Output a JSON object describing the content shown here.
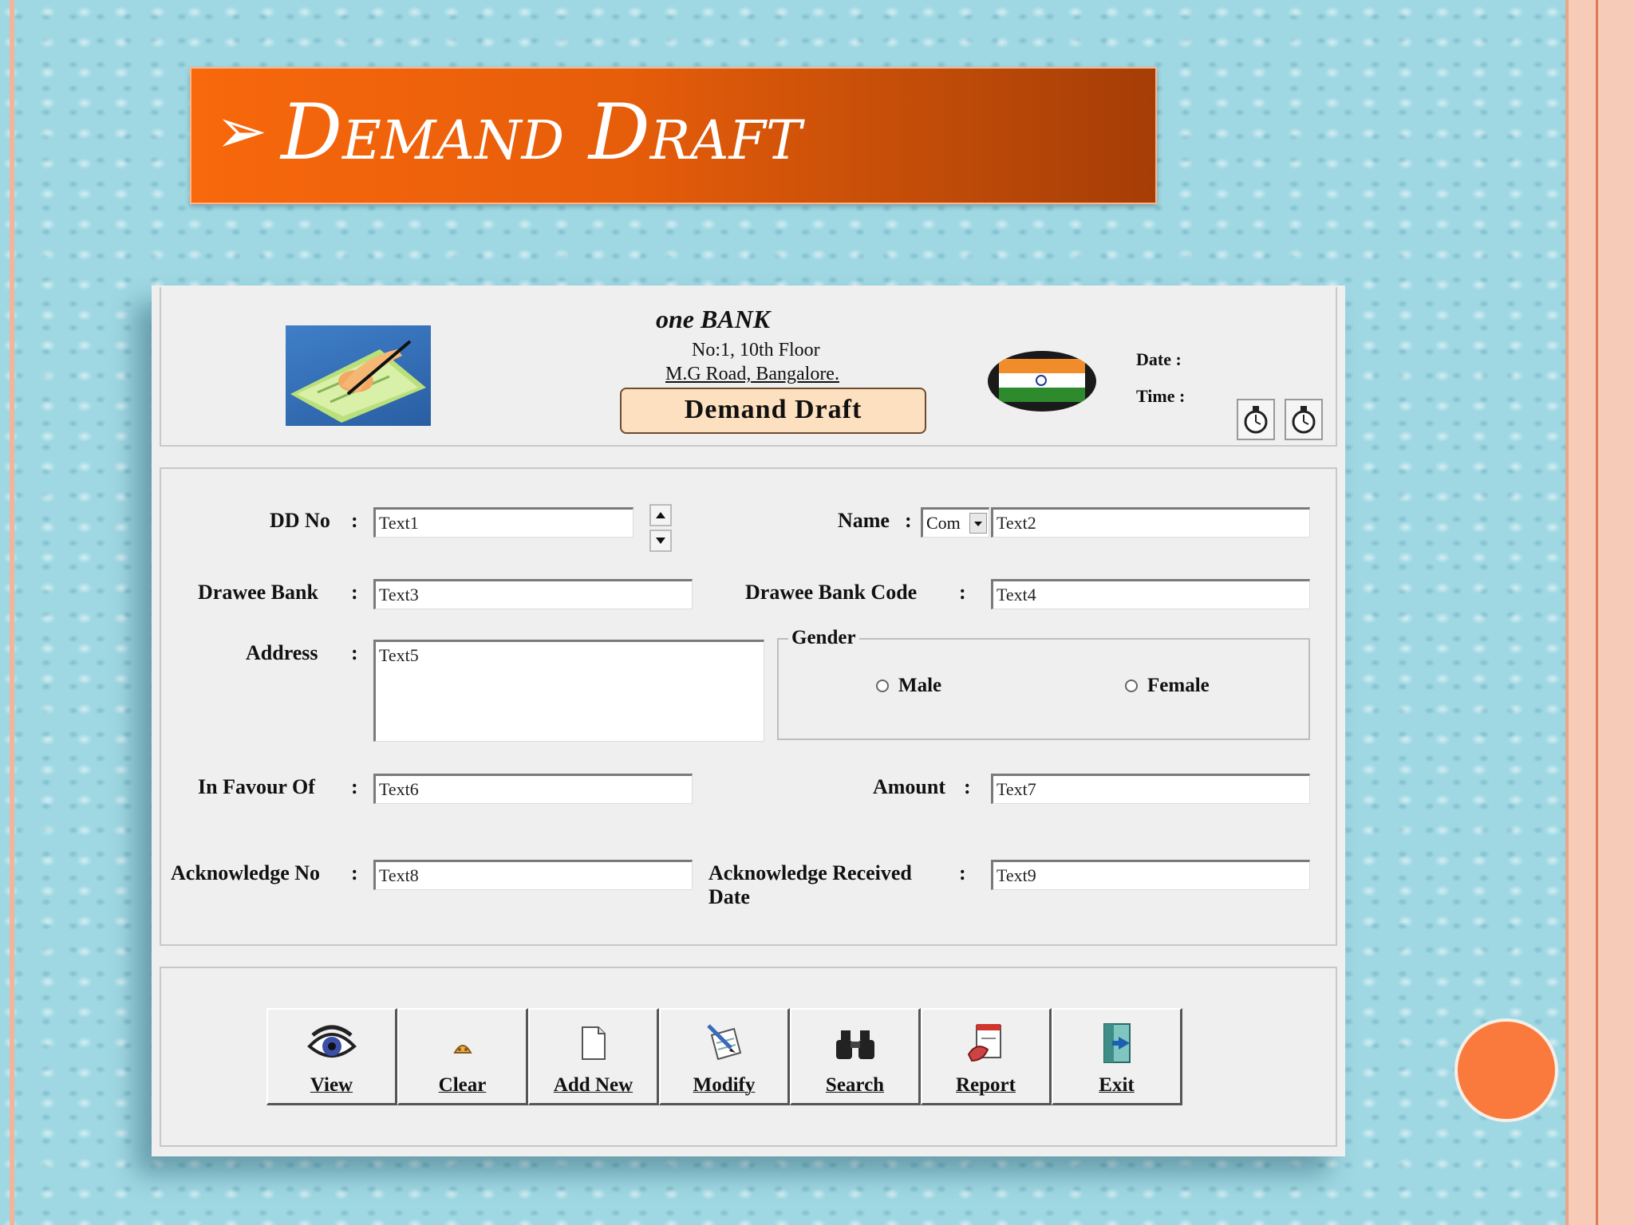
{
  "slide": {
    "title_bullet": "➢",
    "title": "Demand Draft"
  },
  "header": {
    "bank_name": "one   BANK",
    "address_line1": "No:1,  10th Floor",
    "address_line2": "M.G Road,  Bangalore.",
    "form_title": "Demand  Draft",
    "date_label": "Date  :",
    "time_label": "Time :"
  },
  "form": {
    "dd_no": {
      "label": "DD No",
      "value": "Text1"
    },
    "name": {
      "label": "Name",
      "combo_value": "Com",
      "value": "Text2"
    },
    "drawee_bank": {
      "label": "Drawee Bank",
      "value": "Text3"
    },
    "drawee_bank_code": {
      "label": "Drawee Bank Code",
      "value": "Text4"
    },
    "address": {
      "label": "Address",
      "value": "Text5"
    },
    "gender": {
      "label": "Gender",
      "options": [
        "Male",
        "Female"
      ]
    },
    "in_favour_of": {
      "label": "In Favour Of",
      "value": "Text6"
    },
    "amount": {
      "label": "Amount",
      "value": "Text7"
    },
    "acknowledge_no": {
      "label": "Acknowledge No",
      "value": "Text8"
    },
    "acknowledge_received_date": {
      "label_line1": "Acknowledge Received",
      "label_line2": "Date",
      "value": "Text9"
    },
    "colon": ":"
  },
  "buttons": [
    {
      "label": "View",
      "icon": "eye-icon"
    },
    {
      "label": "Clear",
      "icon": "eraser-icon"
    },
    {
      "label": "Add New",
      "icon": "new-document-icon"
    },
    {
      "label": "Modify",
      "icon": "edit-document-icon"
    },
    {
      "label": "Search",
      "icon": "binoculars-icon"
    },
    {
      "label": "Report",
      "icon": "report-icon"
    },
    {
      "label": "Exit",
      "icon": "exit-door-icon"
    }
  ],
  "colors": {
    "title_bar": "#e65d0a",
    "slide_background": "#9fd8e3",
    "accent_dot": "#f97a3c",
    "form_title_box": "#fde0bf"
  }
}
